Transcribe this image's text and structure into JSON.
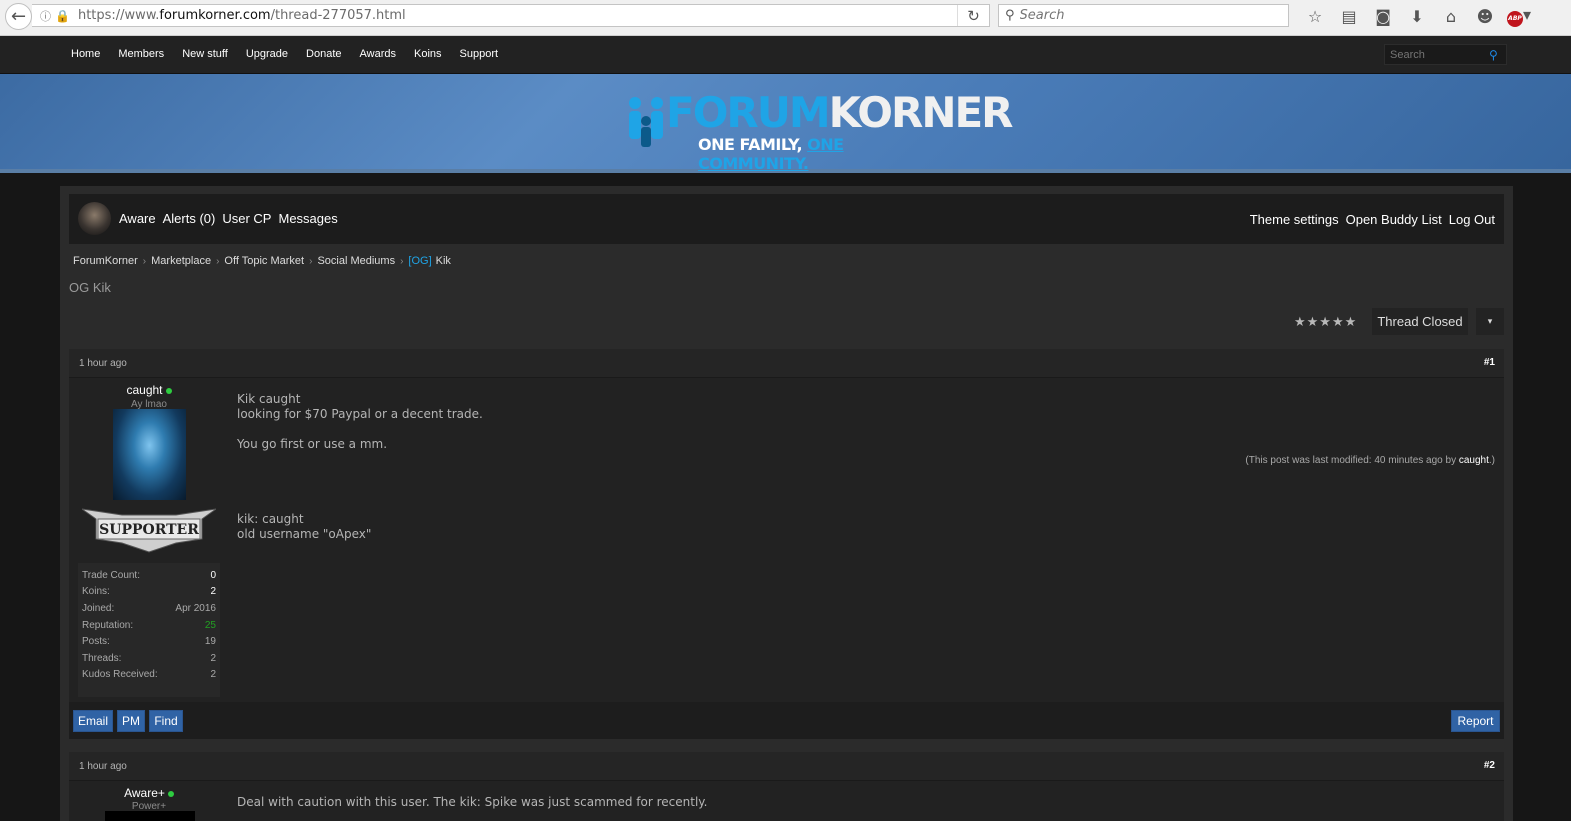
{
  "browser": {
    "url_prefix": "https://www.",
    "url_domain": "forumkorner.com",
    "url_path": "/thread-277057.html",
    "search_placeholder": "Search",
    "abp_label": "ABP"
  },
  "nav": {
    "links": [
      "Home",
      "Members",
      "New stuff",
      "Upgrade",
      "Donate",
      "Awards",
      "Koins",
      "Support"
    ],
    "search_placeholder": "Search"
  },
  "banner": {
    "title_a": "FORUM",
    "title_b": "KORNER",
    "sub_a": "ONE FAMILY,",
    "sub_b": "ONE COMMUNITY."
  },
  "userbar": {
    "left": [
      "Aware",
      "Alerts (0)",
      "User CP",
      "Messages"
    ],
    "right": [
      "Theme settings",
      "Open Buddy List",
      "Log Out"
    ]
  },
  "breadcrumb": {
    "items": [
      "ForumKorner",
      "Marketplace",
      "Off Topic Market",
      "Social Mediums"
    ],
    "current_prefix": "[OG]",
    "current": "Kik",
    "separator": "›"
  },
  "thread": {
    "title": "OG Kik",
    "stars": "★★★★★",
    "closed_label": "Thread Closed",
    "dropdown_glyph": "▾"
  },
  "posts": [
    {
      "time": "1 hour ago",
      "num": "#1",
      "username": "caught",
      "usertitle": "Ay lmao",
      "badge": "SUPPORTER",
      "stats": [
        {
          "label": "Trade Count:",
          "value": "0"
        },
        {
          "label": "Koins:",
          "value": "2"
        },
        {
          "label": "Joined:",
          "value": "Apr 2016"
        },
        {
          "label": "Reputation:",
          "value": "25"
        },
        {
          "label": "Posts:",
          "value": "19"
        },
        {
          "label": "Threads:",
          "value": "2"
        },
        {
          "label": "Kudos Received:",
          "value": "2"
        }
      ],
      "body": [
        "Kik caught",
        "looking for $70 Paypal or a decent trade.",
        "",
        "You go first or use a mm.",
        "",
        "",
        "",
        "",
        "kik: caught",
        "old username \"oApex\""
      ],
      "modified_prefix": "(This post was last modified: 40 minutes ago by ",
      "modified_user": "caught",
      "modified_suffix": ".)",
      "buttons": [
        "Email",
        "PM",
        "Find"
      ],
      "report": "Report"
    },
    {
      "time": "1 hour ago",
      "num": "#2",
      "username": "Aware+",
      "usertitle": "Power+",
      "body": "Deal with caution with this user. The kik: Spike was just scammed for recently."
    }
  ],
  "colors": {
    "accent": "#1fa4e6",
    "button": "#3063a5",
    "online": "#2ecc40",
    "reputation": "#22a022"
  }
}
